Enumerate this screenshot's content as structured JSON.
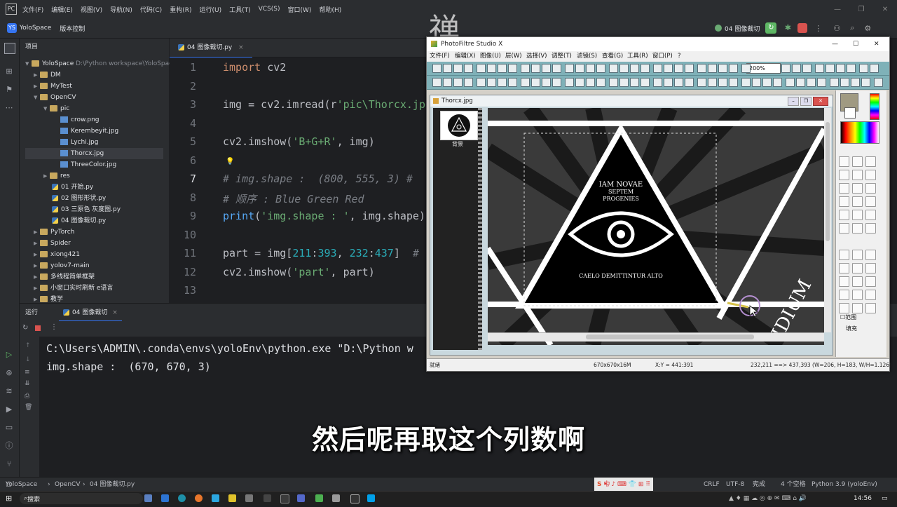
{
  "menubar": {
    "logo": "PC",
    "items": [
      "文件(F)",
      "编辑(E)",
      "视图(V)",
      "导航(N)",
      "代码(C)",
      "重构(R)",
      "运行(U)",
      "工具(T)",
      "VCS(S)",
      "窗口(W)",
      "帮助(H)"
    ]
  },
  "toolbar": {
    "project_badge": "YS",
    "project": "YoloSpace",
    "vcs": "版本控制",
    "run_config": "04 图像裁切"
  },
  "watermark": "禅",
  "project_panel": {
    "title": "项目",
    "root": "YoloSpace",
    "root_path": "D:\\Python workspace\\YoloSpace",
    "items": {
      "dm": "DM",
      "mytest": "MyTest",
      "opencv": "OpenCV",
      "pic": "pic",
      "f1": "crow.png",
      "f2": "Kerembeyit.jpg",
      "f3": "Lychi.jpg",
      "f4": "Thorcx.jpg",
      "f5": "ThreeColor.jpg",
      "res": "res",
      "p1": "01 开始.py",
      "p2": "02 图形形状.py",
      "p3": "03 三原色 灰度图.py",
      "p4": "04 图像裁切.py",
      "pytorch": "PyTorch",
      "spider": "Spider",
      "xiong": "xiong421",
      "yolov7": "yolov7-main",
      "multi": "多线程简单框架",
      "small": "小窗口实时刷新 e语言",
      "teach": "教学"
    }
  },
  "editor": {
    "tab": "04 图像裁切.py",
    "line_numbers": [
      "1",
      "2",
      "3",
      "4",
      "5",
      "6",
      "7",
      "8",
      "9",
      "10",
      "11",
      "12",
      "13"
    ]
  },
  "run_panel": {
    "label": "运行",
    "tab": "04 图像裁切",
    "line1": "C:\\Users\\ADMIN\\.conda\\envs\\yoloEnv\\python.exe \"D:\\Python w",
    "line2": "img.shape :  (670, 670, 3)"
  },
  "subtitle": "然后呢再取这个列数啊",
  "photofiltre": {
    "title": "PhotoFiltre Studio X",
    "menu": [
      "文件(F)",
      "编辑(X)",
      "图像(U)",
      "层(W)",
      "选择(V)",
      "调整(T)",
      "滤镜(S)",
      "查看(G)",
      "工具(R)",
      "窗口(P)",
      "?"
    ],
    "zoom": "200%",
    "doc_title": "Thorcx.jpg",
    "layer_label": "背景",
    "canvas_text": {
      "line1": "IAM NOVAE",
      "line2": "SEPTEM",
      "line3": "PROGENIES",
      "line4": "CAELO DEMITTINTUR ALTO",
      "side": "IDIUM"
    },
    "tools": {
      "range": "范围",
      "fill": "填充"
    },
    "status": {
      "ready": "就绪",
      "size": "670x670x16M",
      "xy": "X:Y = 441:391",
      "sel": "232,211 ==> 437,393 (W=206, H=183, W/H=1.126)"
    },
    "accent": "#7fb1b8"
  },
  "statusbar": {
    "breadcrumb": [
      "YoloSpace",
      "OpenCV",
      "04 图像裁切.py"
    ],
    "ime": "中",
    "crlf": "CRLF",
    "encoding": "UTF-8",
    "status": "完成",
    "indent": "4 个空格",
    "interpreter": "Python 3.9 (yoloEnv)"
  },
  "taskbar": {
    "search": "搜索",
    "time": "14:56"
  }
}
